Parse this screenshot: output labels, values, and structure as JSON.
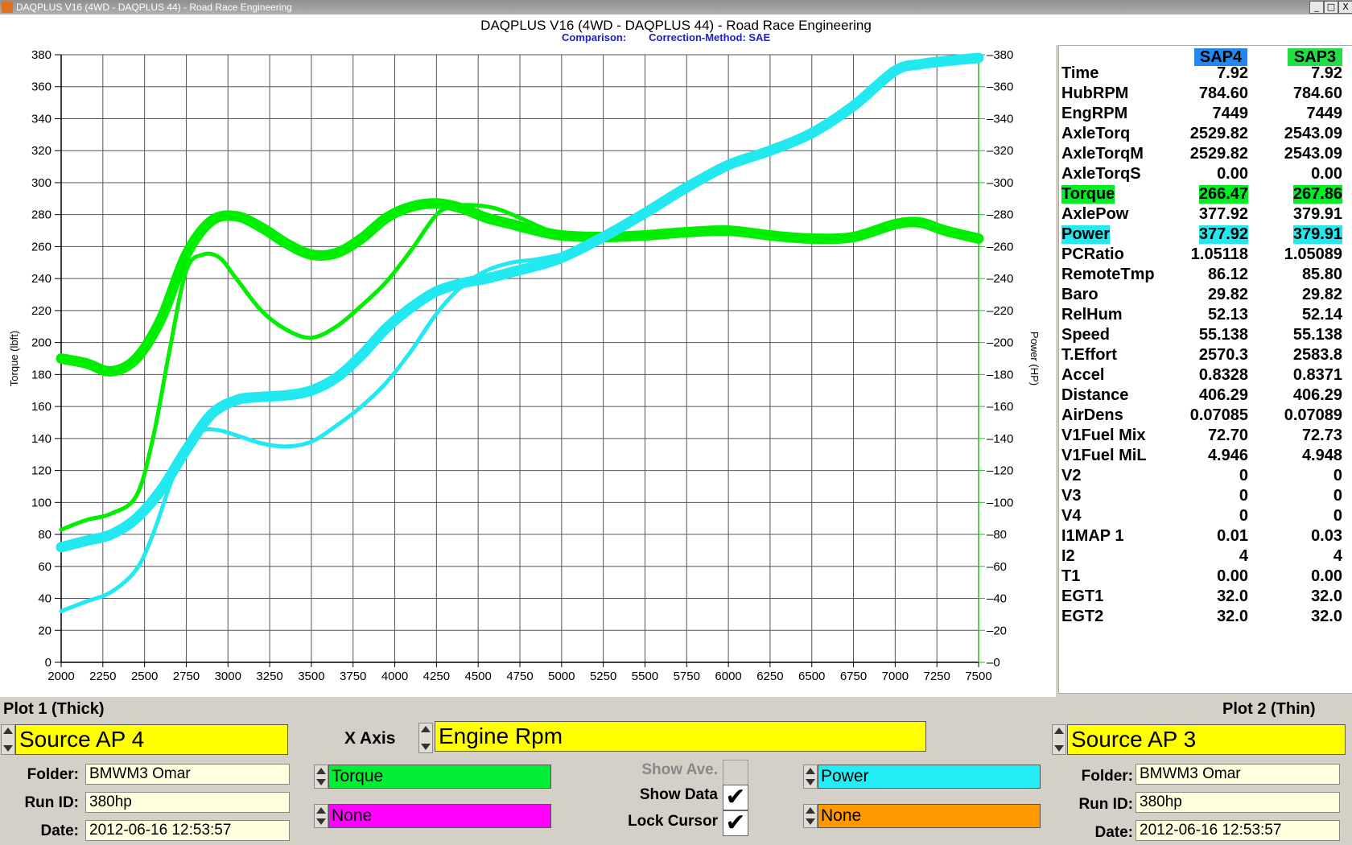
{
  "window": {
    "title": "DAQPLUS V16 (4WD - DAQPLUS 44) - Road Race Engineering",
    "buttons": [
      "_",
      "□",
      "X"
    ]
  },
  "header": {
    "title": "DAQPLUS V16 (4WD - DAQPLUS 44) - Road Race Engineering",
    "comparison": "Comparison:",
    "correction": "Correction-Method: SAE"
  },
  "chart_data": {
    "type": "line",
    "xlabel": "",
    "ylabel": "Torque (lbft)",
    "y2label": "Power (HP)",
    "xlim": [
      2000,
      7500
    ],
    "ylim": [
      0,
      380
    ],
    "x_ticks": [
      "2000",
      "2250",
      "2500",
      "2750",
      "3000",
      "3250",
      "3500",
      "3750",
      "4000",
      "4250",
      "4500",
      "4750",
      "5000",
      "5250",
      "5500",
      "5750",
      "6000",
      "6250",
      "6500",
      "6750",
      "7000",
      "7250",
      "7500"
    ],
    "y_ticks": [
      "0",
      "20",
      "40",
      "60",
      "80",
      "100",
      "120",
      "140",
      "160",
      "180",
      "200",
      "220",
      "240",
      "260",
      "280",
      "300",
      "320",
      "340",
      "360",
      "380"
    ],
    "grid": true,
    "series": [
      {
        "name": "Torque",
        "plot": "Plot 1 (Thick)",
        "color": "#00ee00",
        "width": "thick",
        "x": [
          2000,
          2150,
          2300,
          2450,
          2600,
          2750,
          2900,
          3050,
          3200,
          3350,
          3500,
          3650,
          3800,
          3950,
          4100,
          4250,
          4400,
          4550,
          4700,
          4850,
          5000,
          5250,
          5500,
          5750,
          6000,
          6250,
          6500,
          6750,
          7000,
          7150,
          7300,
          7500
        ],
        "y": [
          190,
          187,
          182,
          190,
          215,
          255,
          276,
          279,
          272,
          262,
          255,
          256,
          265,
          278,
          285,
          287,
          284,
          278,
          274,
          270,
          267,
          266,
          267,
          269,
          270,
          267,
          265,
          266,
          274,
          275,
          270,
          265
        ]
      },
      {
        "name": "Power",
        "plot": "Plot 1 (Thick)",
        "color": "#22e8f0",
        "width": "thick",
        "x": [
          2000,
          2150,
          2300,
          2450,
          2600,
          2750,
          2900,
          3050,
          3200,
          3350,
          3500,
          3650,
          3800,
          3950,
          4100,
          4250,
          4400,
          4550,
          4700,
          4850,
          5000,
          5250,
          5500,
          5750,
          6000,
          6250,
          6500,
          6750,
          7000,
          7150,
          7300,
          7500
        ],
        "y": [
          72,
          76,
          80,
          90,
          108,
          133,
          155,
          164,
          166,
          167,
          170,
          178,
          192,
          209,
          222,
          232,
          237,
          240,
          244,
          248,
          253,
          266,
          281,
          297,
          311,
          320,
          331,
          348,
          370,
          374,
          376,
          378
        ]
      },
      {
        "name": "Torque",
        "plot": "Plot 2 (Thin)",
        "color": "#00ee00",
        "width": "thin",
        "x": [
          2000,
          2150,
          2300,
          2450,
          2550,
          2650,
          2750,
          2850,
          2950,
          3050,
          3200,
          3350,
          3500,
          3650,
          3800,
          3950,
          4100,
          4250,
          4350,
          4450,
          4600,
          4750,
          4900,
          5000
        ],
        "y": [
          83,
          89,
          93,
          104,
          140,
          195,
          245,
          255,
          253,
          240,
          220,
          208,
          203,
          210,
          223,
          238,
          258,
          280,
          285,
          286,
          284,
          278,
          271,
          268
        ]
      },
      {
        "name": "Power",
        "plot": "Plot 2 (Thin)",
        "color": "#22e8f0",
        "width": "thin",
        "x": [
          2000,
          2150,
          2300,
          2450,
          2550,
          2650,
          2750,
          2850,
          2950,
          3050,
          3200,
          3350,
          3500,
          3650,
          3800,
          3950,
          4100,
          4250,
          4400,
          4550,
          4700,
          4850,
          5000
        ],
        "y": [
          32,
          38,
          44,
          58,
          80,
          110,
          136,
          145,
          145,
          142,
          137,
          135,
          138,
          148,
          160,
          175,
          195,
          218,
          235,
          245,
          250,
          252,
          255
        ]
      }
    ]
  },
  "data_table": {
    "columns": [
      "SAP4",
      "SAP3"
    ],
    "column_colors": [
      "#2288ee",
      "#22dd44"
    ],
    "rows": [
      {
        "label": "Time",
        "v1": "7.92",
        "v2": "7.92"
      },
      {
        "label": "HubRPM",
        "v1": "784.60",
        "v2": "784.60"
      },
      {
        "label": "EngRPM",
        "v1": "7449",
        "v2": "7449"
      },
      {
        "label": "AxleTorq",
        "v1": "2529.82",
        "v2": "2543.09"
      },
      {
        "label": "AxleTorqM",
        "v1": "2529.82",
        "v2": "2543.09"
      },
      {
        "label": "AxleTorqS",
        "v1": "0.00",
        "v2": "0.00"
      },
      {
        "label": "Torque",
        "v1": "266.47",
        "v2": "267.86",
        "highlight": "green"
      },
      {
        "label": "AxlePow",
        "v1": "377.92",
        "v2": "379.91"
      },
      {
        "label": "Power",
        "v1": "377.92",
        "v2": "379.91",
        "highlight": "cyan"
      },
      {
        "label": "PCRatio",
        "v1": "1.05118",
        "v2": "1.05089"
      },
      {
        "label": "RemoteTmp",
        "v1": "86.12",
        "v2": "85.80"
      },
      {
        "label": "Baro",
        "v1": "29.82",
        "v2": "29.82"
      },
      {
        "label": "RelHum",
        "v1": "52.13",
        "v2": "52.14"
      },
      {
        "label": "Speed",
        "v1": "55.138",
        "v2": "55.138"
      },
      {
        "label": "T.Effort",
        "v1": "2570.3",
        "v2": "2583.8"
      },
      {
        "label": "Accel",
        "v1": "0.8328",
        "v2": "0.8371"
      },
      {
        "label": "Distance",
        "v1": "406.29",
        "v2": "406.29"
      },
      {
        "label": "AirDens",
        "v1": "0.07085",
        "v2": "0.07089"
      },
      {
        "label": "V1Fuel Mix",
        "v1": "72.70",
        "v2": "72.73"
      },
      {
        "label": "V1Fuel MiL",
        "v1": "4.946",
        "v2": "4.948"
      },
      {
        "label": "V2",
        "v1": "0",
        "v2": "0"
      },
      {
        "label": "V3",
        "v1": "0",
        "v2": "0"
      },
      {
        "label": "V4",
        "v1": "0",
        "v2": "0"
      },
      {
        "label": "I1MAP 1",
        "v1": "0.01",
        "v2": "0.03"
      },
      {
        "label": "I2",
        "v1": "4",
        "v2": "4"
      },
      {
        "label": "T1",
        "v1": "0.00",
        "v2": "0.00"
      },
      {
        "label": "EGT1",
        "v1": "32.0",
        "v2": "32.0"
      },
      {
        "label": "EGT2",
        "v1": "32.0",
        "v2": "32.0"
      }
    ]
  },
  "plot1": {
    "label": "Plot 1 (Thick)",
    "source": "Source AP 4",
    "folder_label": "Folder:",
    "folder": "BMWM3 Omar",
    "runid_label": "Run ID:",
    "runid": "380hp",
    "date_label": "Date:",
    "date": "2012-06-16 12:53:57"
  },
  "plot2": {
    "label": "Plot 2 (Thin)",
    "source": "Source AP 3",
    "folder_label": "Folder:",
    "folder": "BMWM3 Omar",
    "runid_label": "Run ID:",
    "runid": "380hp",
    "date_label": "Date:",
    "date": "2012-06-16 12:53:57"
  },
  "xaxis": {
    "label": "X Axis",
    "value": "Engine Rpm"
  },
  "channels": {
    "left1": {
      "value": "Torque",
      "color": "#00ee33"
    },
    "left2": {
      "value": "None",
      "color": "#ff00ff"
    },
    "right1": {
      "value": "Power",
      "color": "#22eef8"
    },
    "right2": {
      "value": "None",
      "color": "#ff9900"
    }
  },
  "options": {
    "show_ave": {
      "label": "Show Ave.",
      "checked": false
    },
    "show_data": {
      "label": "Show Data",
      "checked": true
    },
    "lock_cursor": {
      "label": "Lock Cursor",
      "checked": true
    }
  }
}
